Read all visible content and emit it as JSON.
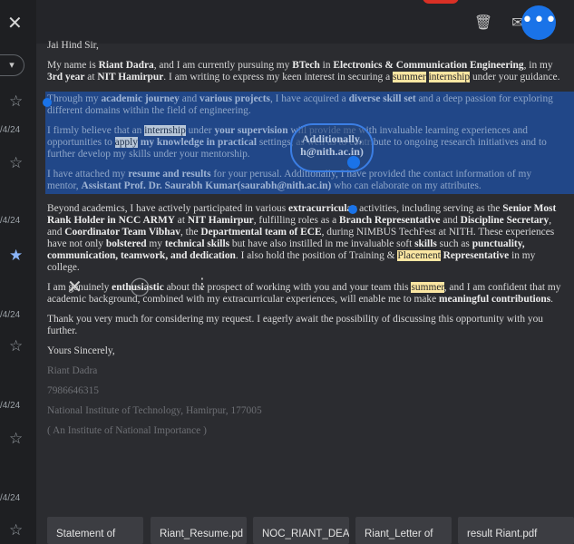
{
  "list": {
    "dates": [
      "/4/24",
      "/4/24",
      "/4/24",
      "/4/24",
      "/4/24",
      "/4/24"
    ],
    "starred_row": 4
  },
  "toolbar": {
    "close_icon": "close-icon",
    "delete_icon": "trash-icon",
    "mail_icon": "mail-icon",
    "more_icon": "more-horizontal-icon"
  },
  "email": {
    "greeting": "Jai Hind Sir,",
    "p1": {
      "t1": "My name is ",
      "name": "Riant Dadra",
      "t2": ", and I am currently pursuing my ",
      "degree": "BTech",
      "t3": " in ",
      "branch": "Electronics & Communication Engineering",
      "t4": ", in my ",
      "year": "3rd year",
      "t5": " at ",
      "inst": "NIT Hamirpur",
      "t6": ". I am writing to express my keen interest in securing a ",
      "hl1": "summer",
      "t7": " ",
      "hl2": "internship",
      "t8": " under your guidance."
    },
    "p2": {
      "t1": "Through my ",
      "b1": "academic journey",
      "t2": " and ",
      "b2": "various projects",
      "t3": ", I have acquired a ",
      "b3": "diverse skill set",
      "t4": " and a deep passion for exploring different domains within the field of engineering."
    },
    "p3": {
      "t1": "I firmly believe that an ",
      "hl1": "internship",
      "t2": " under ",
      "b1": "your supervision",
      "t3": " will provide me with invaluable learning experiences and opportunities to ",
      "hl2": "apply",
      "t4": " ",
      "b2": "my knowledge in practical",
      "t5": " settings, as well as to contribute to ongoing research initiatives and to further develop my skills under your mentorship."
    },
    "p4": {
      "t1": "I have attached my ",
      "b1": "resume and results",
      "t2": " for your perusal. Additionally, I have provided the contact information of my mentor, ",
      "b2": "Assistant Prof. Dr. Saurabh Kumar(saurabh@nith.ac.in)",
      "t3": " who can elaborate on my attributes."
    },
    "p5": {
      "t1": "Beyond academics, I have actively participated in various ",
      "b1": "extracurricular",
      "t2": " activities, including serving as the ",
      "b2": "Senior Most Rank Holder in NCC ARMY",
      "t3": " at ",
      "b3": "NIT Hamirpur",
      "t4": ", fulfilling roles as a ",
      "b4": "Branch Representative",
      "t5": " and ",
      "b5": "Discipline Secretary",
      "t6": ", and ",
      "b6": "Coordinator Team Vibhav",
      "t7": ", the ",
      "b7": "Departmental team of ECE",
      "t8": ", during NIMBUS TechFest at NITH. These experiences have not only ",
      "b8": "bolstered",
      "t9": " my ",
      "b9": "technical skills",
      "t10": " but have also instilled in me invaluable soft ",
      "b10": "skills",
      "t11": " such as ",
      "b11": "punctuality, communication, teamwork, and dedication",
      "t12": ". I also hold the position of Training & ",
      "hl1": "Placement",
      "t13": " ",
      "b12": "Representative",
      "t14": " in my college."
    },
    "p6": {
      "t1": "I am genuinely ",
      "b1": "enthusiastic",
      "t2": " about the prospect of working with you and your team this ",
      "hl1": "summer",
      "t3": ", and I am confident that my academic background, combined with my extracurricular experiences, will enable me to make ",
      "b2": "meaningful contributions",
      "t4": "."
    },
    "p7": "Thank you very much for considering my request. I eagerly await the possibility of discussing this opportunity with you further.",
    "closing": "Yours Sincerely,",
    "signature": {
      "name": "Riant Dadra",
      "phone": "7986646315",
      "org": "National Institute of Technology, Hamirpur, 177005",
      "tag": "( An Institute of National Importance )"
    }
  },
  "lens": {
    "line1": "Additionally,",
    "line2": "h@nith.ac.in)"
  },
  "attachments": [
    "Statement of",
    "Riant_Resume.pd",
    "NOC_RIANT_DEA",
    "Riant_Letter of",
    "result Riant.pdf"
  ]
}
